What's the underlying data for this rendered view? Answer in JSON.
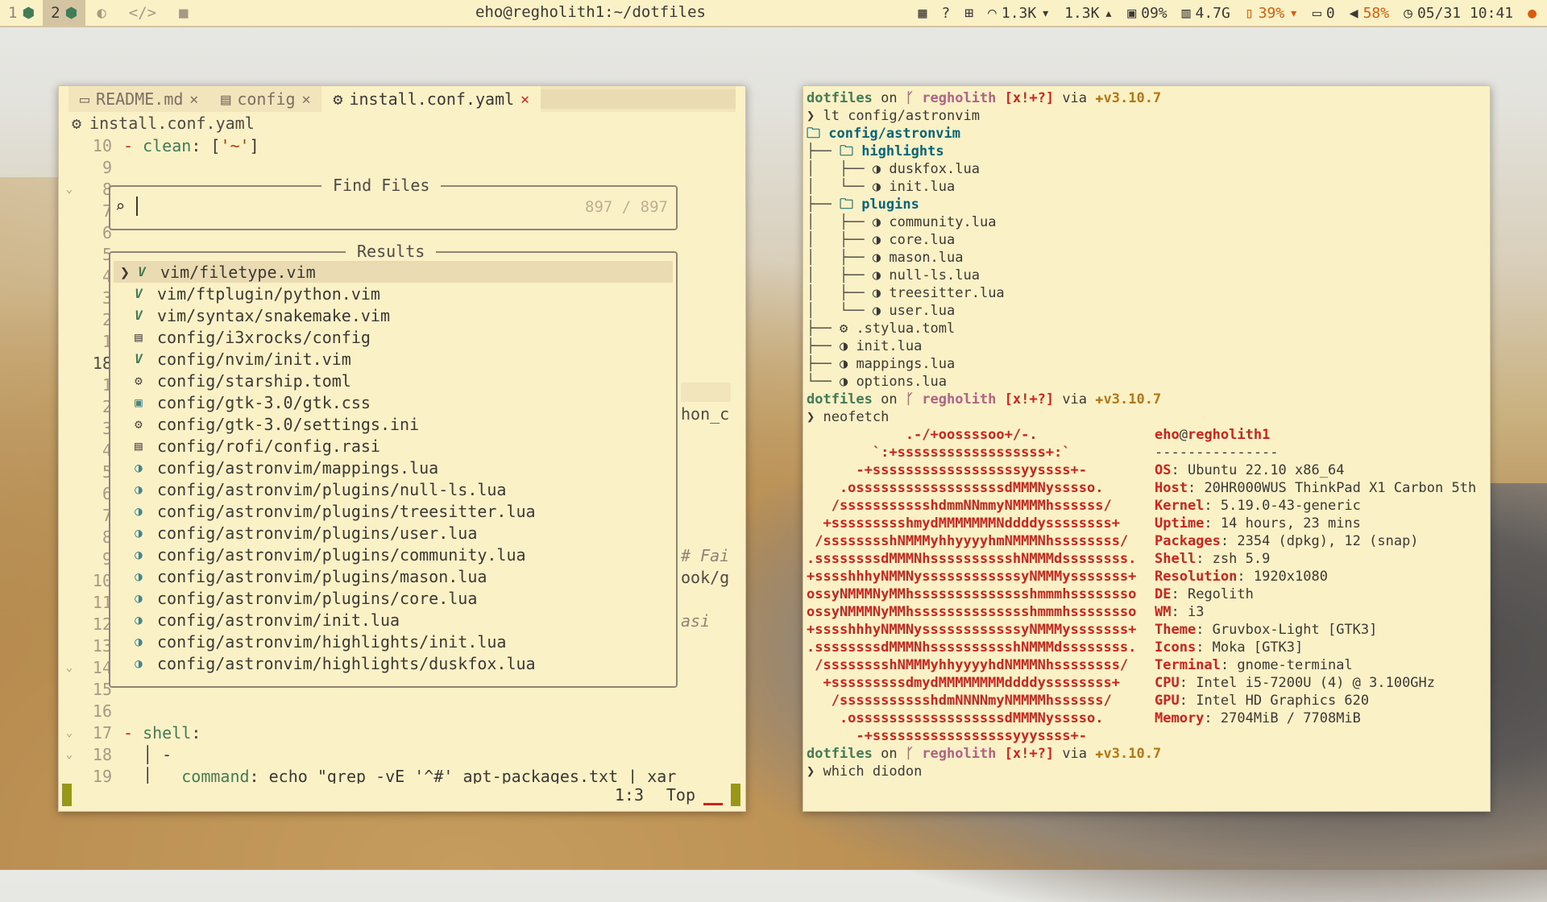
{
  "topbar": {
    "workspaces": [
      {
        "num": "1",
        "active": false
      },
      {
        "num": "2",
        "active": true
      }
    ],
    "window_title": "eho@regholith1:~/dotfiles",
    "net_down": "1.3K",
    "net_up": "1.3K",
    "cpu": "09%",
    "mem": "4.7G",
    "battery": "39%",
    "notifications": "0",
    "volume": "58%",
    "datetime": "05/31 10:41"
  },
  "editor": {
    "tabs": [
      {
        "label": "README.md",
        "active": false
      },
      {
        "label": "config",
        "active": false
      },
      {
        "label": "install.conf.yaml",
        "active": true
      }
    ],
    "breadcrumb": "install.conf.yaml",
    "lines": [
      {
        "num": "10",
        "text": "clean: ['~']",
        "fold": ""
      },
      {
        "num": "9",
        "text": "",
        "fold": ""
      },
      {
        "num": "8",
        "text": "",
        "fold": "v"
      },
      {
        "num": "7",
        "text": "",
        "fold": ""
      },
      {
        "num": "6",
        "text": "",
        "fold": ""
      },
      {
        "num": "5",
        "text": "",
        "fold": ""
      },
      {
        "num": "4",
        "text": "",
        "fold": ""
      },
      {
        "num": "3",
        "text": "",
        "fold": ""
      },
      {
        "num": "2",
        "text": "",
        "fold": ""
      },
      {
        "num": "1",
        "text": "",
        "fold": ""
      },
      {
        "num": "18",
        "text": "",
        "fold": ""
      },
      {
        "num": "1",
        "text": "",
        "fold": ""
      },
      {
        "num": "2",
        "text": "",
        "fold": ""
      },
      {
        "num": "3",
        "text": "",
        "fold": ""
      },
      {
        "num": "4",
        "text": "",
        "fold": ""
      },
      {
        "num": "5",
        "text": "",
        "fold": ""
      },
      {
        "num": "6",
        "text": "",
        "fold": ""
      },
      {
        "num": "7",
        "text": "",
        "fold": ""
      },
      {
        "num": "8",
        "text": "",
        "fold": ""
      },
      {
        "num": "9",
        "text": "",
        "fold": ""
      },
      {
        "num": "10",
        "text": "",
        "fold": ""
      },
      {
        "num": "11",
        "text": "",
        "fold": ""
      },
      {
        "num": "12",
        "text": "",
        "fold": ""
      },
      {
        "num": "13",
        "text": "",
        "fold": ""
      },
      {
        "num": "14",
        "text": "",
        "fold": "v"
      },
      {
        "num": "15",
        "text": "",
        "fold": ""
      },
      {
        "num": "16",
        "text": "",
        "fold": ""
      },
      {
        "num": "17",
        "text": "shell:",
        "fold": "v"
      },
      {
        "num": "18",
        "text": "-",
        "fold": "v"
      },
      {
        "num": "19",
        "text": "command: echo \"grep -vE '^#' apt-packages.txt | xar",
        "fold": ""
      }
    ],
    "peek": {
      "hon_c": "hon_c",
      "fai": "# Fai",
      "ookg": "ook/g",
      "asi": "asi"
    },
    "status_pos": "1:3",
    "status_scroll": "Top"
  },
  "telescope": {
    "prompt_title": "Find Files",
    "count": "897 / 897",
    "results_title": "Results",
    "results": [
      {
        "icon": "vim",
        "path": "vim/filetype.vim"
      },
      {
        "icon": "vim",
        "path": "vim/ftplugin/python.vim"
      },
      {
        "icon": "vim",
        "path": "vim/syntax/snakemake.vim"
      },
      {
        "icon": "file",
        "path": "config/i3xrocks/config"
      },
      {
        "icon": "vim",
        "path": "config/nvim/init.vim"
      },
      {
        "icon": "gear",
        "path": "config/starship.toml"
      },
      {
        "icon": "css",
        "path": "config/gtk-3.0/gtk.css"
      },
      {
        "icon": "gear",
        "path": "config/gtk-3.0/settings.ini"
      },
      {
        "icon": "file",
        "path": "config/rofi/config.rasi"
      },
      {
        "icon": "lua",
        "path": "config/astronvim/mappings.lua"
      },
      {
        "icon": "lua",
        "path": "config/astronvim/plugins/null-ls.lua"
      },
      {
        "icon": "lua",
        "path": "config/astronvim/plugins/treesitter.lua"
      },
      {
        "icon": "lua",
        "path": "config/astronvim/plugins/user.lua"
      },
      {
        "icon": "lua",
        "path": "config/astronvim/plugins/community.lua"
      },
      {
        "icon": "lua",
        "path": "config/astronvim/plugins/mason.lua"
      },
      {
        "icon": "lua",
        "path": "config/astronvim/plugins/core.lua"
      },
      {
        "icon": "lua",
        "path": "config/astronvim/init.lua"
      },
      {
        "icon": "lua",
        "path": "config/astronvim/highlights/init.lua"
      },
      {
        "icon": "lua",
        "path": "config/astronvim/highlights/duskfox.lua"
      }
    ]
  },
  "terminal": {
    "prompt": {
      "dir": "dotfiles",
      "on": "on",
      "host": "regholith",
      "git": "[x!+?]",
      "via": "via",
      "python": "v3.10.7"
    },
    "cmd1": "lt config/astronvim",
    "tree": [
      {
        "prefix": "",
        "icon": "folder",
        "text": "config/astronvim",
        "kind": "root"
      },
      {
        "prefix": "├── ",
        "icon": "folder",
        "text": "highlights",
        "kind": "dir"
      },
      {
        "prefix": "│   ├── ",
        "icon": "lua",
        "text": "duskfox.lua",
        "kind": "file"
      },
      {
        "prefix": "│   └── ",
        "icon": "lua",
        "text": "init.lua",
        "kind": "file"
      },
      {
        "prefix": "├── ",
        "icon": "folder",
        "text": "plugins",
        "kind": "dir"
      },
      {
        "prefix": "│   ├── ",
        "icon": "lua",
        "text": "community.lua",
        "kind": "file"
      },
      {
        "prefix": "│   ├── ",
        "icon": "lua",
        "text": "core.lua",
        "kind": "file"
      },
      {
        "prefix": "│   ├── ",
        "icon": "lua",
        "text": "mason.lua",
        "kind": "file"
      },
      {
        "prefix": "│   ├── ",
        "icon": "lua",
        "text": "null-ls.lua",
        "kind": "file"
      },
      {
        "prefix": "│   ├── ",
        "icon": "lua",
        "text": "treesitter.lua",
        "kind": "file"
      },
      {
        "prefix": "│   └── ",
        "icon": "lua",
        "text": "user.lua",
        "kind": "file"
      },
      {
        "prefix": "├── ",
        "icon": "gear",
        "text": ".stylua.toml",
        "kind": "file"
      },
      {
        "prefix": "├── ",
        "icon": "lua",
        "text": "init.lua",
        "kind": "file"
      },
      {
        "prefix": "├── ",
        "icon": "lua",
        "text": "mappings.lua",
        "kind": "file"
      },
      {
        "prefix": "└── ",
        "icon": "lua",
        "text": "options.lua",
        "kind": "file"
      }
    ],
    "cmd2": "neofetch",
    "neofetch_art": [
      "            .-/+oossssoo+/-.",
      "        `:+ssssssssssssssssss+:`",
      "      -+ssssssssssssssssssyyssss+-",
      "    .ossssssssssssssssssdMMMNysssso.",
      "   /ssssssssssshdmmNNmmyNMMMMhssssss/",
      "  +ssssssssshmydMMMMMMMNddddyssssssss+",
      " /sssssssshNMMMyhhyyyyhmNMMMNhssssssss/",
      ".ssssssssdMMMNhsssssssssshNMMMdssssssss.",
      "+sssshhhyNMMNyssssssssssssyNMMMysssssss+",
      "ossyNMMMNyMMhsssssssssssssshmmmhssssssso",
      "ossyNMMMNyMMhsssssssssssssshmmmhssssssso",
      "+sssshhhyNMMNyssssssssssssyNMMMysssssss+",
      ".ssssssssdMMMNhsssssssssshNMMMdssssssss.",
      " /sssssssshNMMMyhhyyyyhdNMMMNhssssssss/",
      "  +sssssssssdmydMMMMMMMMddddyssssssss+",
      "   /ssssssssssshdmNNNNmyNMMMMhssssss/",
      "    .ossssssssssssssssssdMMMNysssso.",
      "      -+sssssssssssssssssyyyssss+-"
    ],
    "neofetch_user": "eho",
    "neofetch_host": "regholith1",
    "neofetch_sep": "---------------",
    "info": [
      {
        "key": "OS",
        "val": "Ubuntu 22.10 x86_64"
      },
      {
        "key": "Host",
        "val": "20HR000WUS ThinkPad X1 Carbon 5th"
      },
      {
        "key": "Kernel",
        "val": "5.19.0-43-generic"
      },
      {
        "key": "Uptime",
        "val": "14 hours, 23 mins"
      },
      {
        "key": "Packages",
        "val": "2354 (dpkg), 12 (snap)"
      },
      {
        "key": "Shell",
        "val": "zsh 5.9"
      },
      {
        "key": "Resolution",
        "val": "1920x1080"
      },
      {
        "key": "DE",
        "val": "Regolith"
      },
      {
        "key": "WM",
        "val": "i3"
      },
      {
        "key": "Theme",
        "val": "Gruvbox-Light [GTK3]"
      },
      {
        "key": "Icons",
        "val": "Moka [GTK3]"
      },
      {
        "key": "Terminal",
        "val": "gnome-terminal"
      },
      {
        "key": "CPU",
        "val": "Intel i5-7200U (4) @ 3.100GHz"
      },
      {
        "key": "GPU",
        "val": "Intel HD Graphics 620"
      },
      {
        "key": "Memory",
        "val": "2704MiB / 7708MiB"
      }
    ],
    "cmd3": "which diodon"
  }
}
